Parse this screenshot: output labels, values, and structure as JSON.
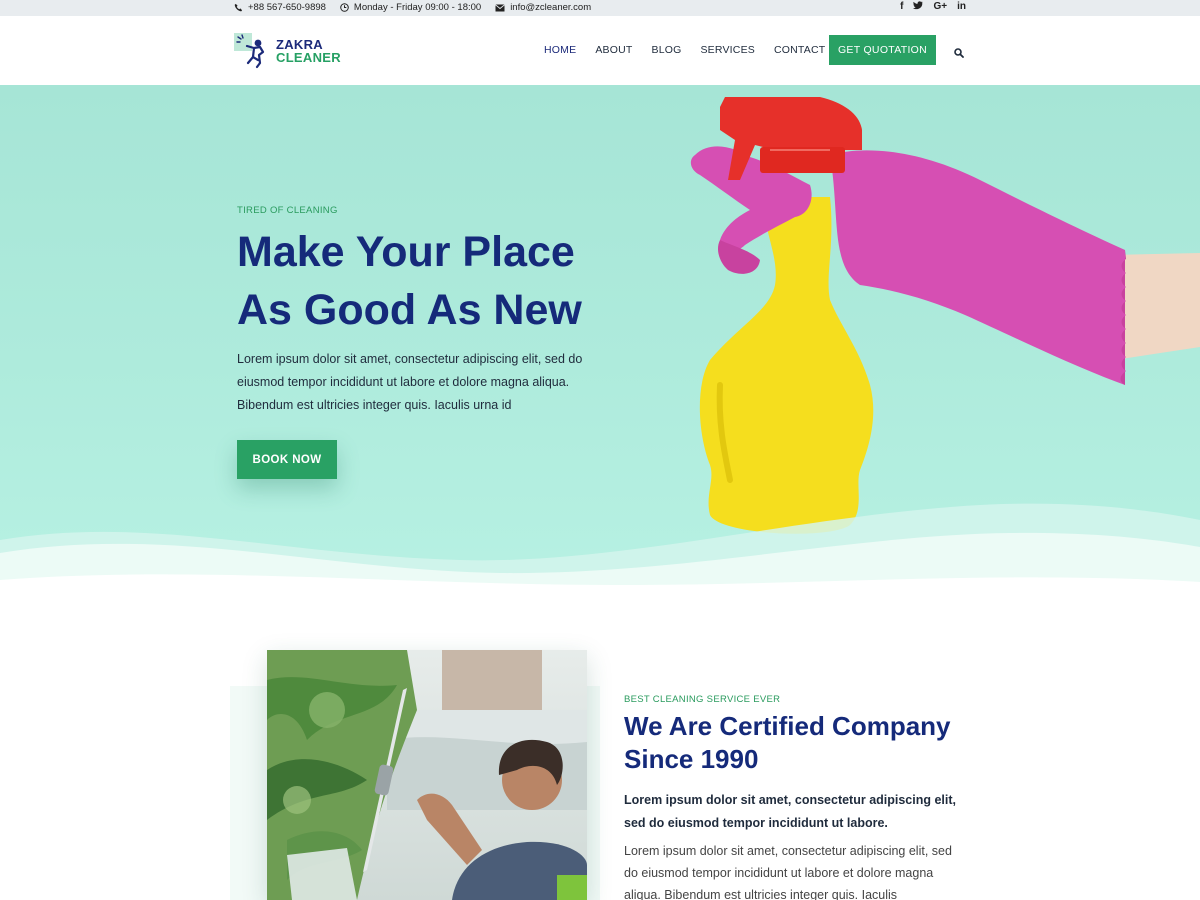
{
  "topbar": {
    "phone": "+88 567-650-9898",
    "hours": "Monday - Friday 09:00 - 18:00",
    "email": "info@zcleaner.com",
    "social_icons": [
      "facebook-icon",
      "twitter-icon",
      "google-plus-icon",
      "linkedin-icon"
    ],
    "social_labels": [
      "f",
      "G+",
      "in"
    ]
  },
  "header": {
    "logo_line1": "ZAKRA",
    "logo_line2": "CLEANER",
    "nav": [
      "HOME",
      "ABOUT",
      "BLOG",
      "SERVICES",
      "CONTACT"
    ],
    "active_nav": "HOME",
    "cta": "GET QUOTATION"
  },
  "hero": {
    "kicker": "TIRED OF CLEANING",
    "title_line1": "Make Your Place",
    "title_line2": "As Good As New",
    "text": "Lorem ipsum dolor sit amet, consectetur adipiscing elit, sed do eiusmod tempor incididunt ut labore et dolore magna aliqua. Bibendum est ultricies integer quis. Iaculis urna id",
    "button": "BOOK NOW"
  },
  "about": {
    "kicker": "BEST CLEANING SERVICE EVER",
    "title_line1": "We Are Certified Company",
    "title_line2": "Since 1990",
    "bold_text": "Lorem ipsum dolor sit amet, consectetur adipiscing elit, sed do eiusmod tempor incididunt ut labore.",
    "text": "Lorem ipsum dolor sit amet, consectetur adipiscing elit, sed do eiusmod tempor incididunt ut labore et dolore magna aliqua. Bibendum est ultricies integer quis. Iaculis"
  },
  "colors": {
    "brand_navy": "#152a7a",
    "brand_green": "#29a164",
    "hero_bg": "#a6e5d6"
  }
}
